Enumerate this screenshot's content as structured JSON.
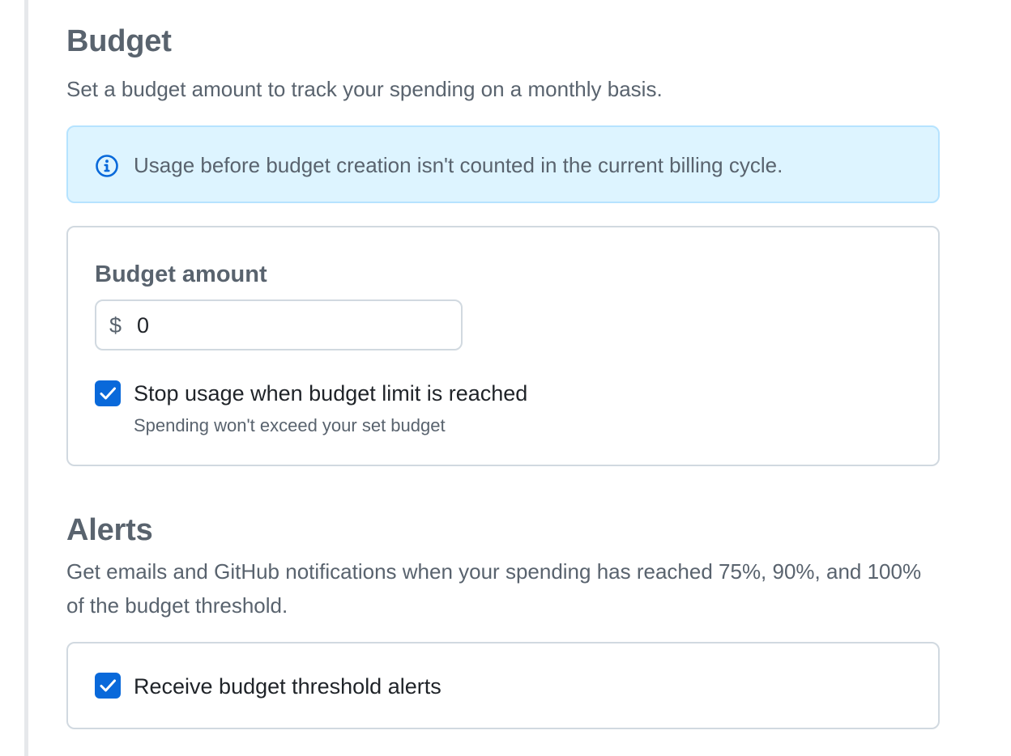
{
  "budget": {
    "title": "Budget",
    "description": "Set a budget amount to track your spending on a monthly basis.",
    "info_banner": "Usage before budget creation isn't counted in the current billing cycle.",
    "amount_label": "Budget amount",
    "currency_symbol": "$",
    "amount_value": "0",
    "stop_usage": {
      "checked": true,
      "label": "Stop usage when budget limit is reached",
      "hint": "Spending won't exceed your set budget"
    }
  },
  "alerts": {
    "title": "Alerts",
    "description": "Get emails and GitHub notifications when your spending has reached 75%, 90%, and 100% of the budget threshold.",
    "receive_alerts": {
      "checked": true,
      "label": "Receive budget threshold alerts"
    }
  },
  "colors": {
    "accent": "#0969da",
    "info_bg": "#ddf4ff",
    "info_border": "#b6e3ff",
    "muted_text": "#59636e",
    "border": "#d1d9e0"
  }
}
